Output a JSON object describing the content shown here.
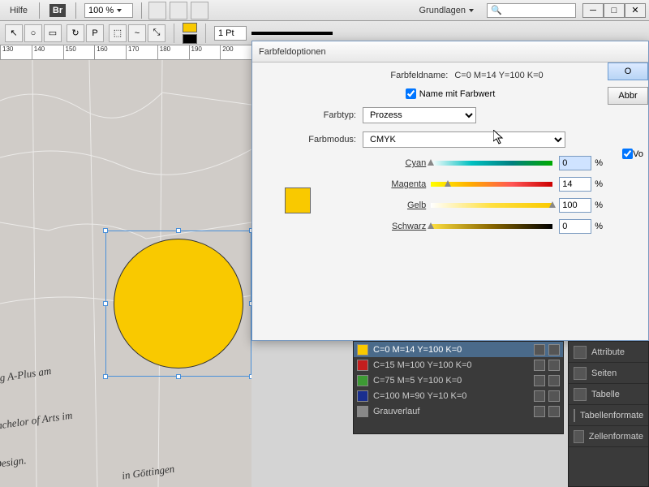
{
  "menubar": {
    "help": "Hilfe",
    "bridge": "Br",
    "zoom": "100 %",
    "workspace": "Grundlagen",
    "search_placeholder": ""
  },
  "toolbar": {
    "fill_color": "#f9c900",
    "stroke_color": "#000000",
    "stroke_weight": "1 Pt"
  },
  "ruler": [
    "130",
    "140",
    "150",
    "160",
    "170",
    "180",
    "190",
    "200"
  ],
  "canvas": {
    "circle_fill": "#f9c900",
    "text1": "eig A-Plus am",
    "text2": ". Grades Bachelor of Arts im",
    "text3": "n und Design.",
    "text4": "in Göttingen"
  },
  "dialog": {
    "title": "Farbfeldoptionen",
    "name_label": "Farbfeldname:",
    "name_value": "C=0 M=14 Y=100 K=0",
    "name_with_value": "Name mit Farbwert",
    "type_label": "Farbtyp:",
    "type_value": "Prozess",
    "mode_label": "Farbmodus:",
    "mode_value": "CMYK",
    "sliders": [
      {
        "label": "Cyan",
        "value": "0",
        "pos": 0,
        "gradient": "linear-gradient(to right,#fff,#00c0c0,#008080,#0a0)"
      },
      {
        "label": "Magenta",
        "value": "14",
        "pos": 14,
        "gradient": "linear-gradient(to right,#ff0,#fa0,#f55,#c00)"
      },
      {
        "label": "Gelb",
        "value": "100",
        "pos": 100,
        "gradient": "linear-gradient(to right,#fff,#ffe040,#f9c900)"
      },
      {
        "label": "Schwarz",
        "value": "0",
        "pos": 0,
        "gradient": "linear-gradient(to right,#ffe040,#886600,#000)"
      }
    ],
    "percent": "%",
    "btn_ok": "O",
    "btn_cancel": "Abbr",
    "vorschau": "Vo"
  },
  "swatches": [
    {
      "name": "C=0 M=14 Y=100 K=0",
      "color": "#f9c900",
      "sel": true
    },
    {
      "name": "C=15 M=100 Y=100 K=0",
      "color": "#c41e1e",
      "sel": false
    },
    {
      "name": "C=75 M=5 Y=100 K=0",
      "color": "#3d9a34",
      "sel": false
    },
    {
      "name": "C=100 M=90 Y=10 K=0",
      "color": "#1a2f8f",
      "sel": false
    },
    {
      "name": "Grauverlauf",
      "color": "#888",
      "sel": false
    }
  ],
  "side_panels": [
    "Attribute",
    "Seiten",
    "Tabelle",
    "Tabellenformate",
    "Zellenformate"
  ]
}
